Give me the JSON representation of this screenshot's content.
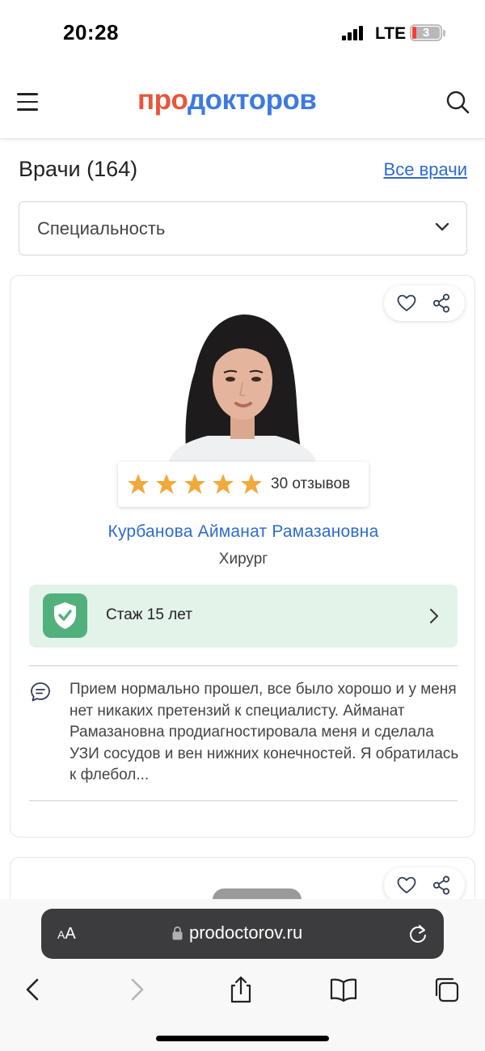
{
  "status_bar": {
    "time": "20:28",
    "network": "LTE",
    "battery": "3"
  },
  "header": {
    "logo_part1": "про",
    "logo_part2": "докторов"
  },
  "section": {
    "title": "Врачи (164)",
    "all_link": "Все врачи"
  },
  "filter": {
    "specialty_label": "Специальность"
  },
  "doctor": {
    "rating_stars": 5,
    "reviews": "30 отзывов",
    "name": "Курбанова Айманат Рамазановна",
    "specialty": "Хирург",
    "experience": "Стаж 15 лет",
    "review_text": "Прием нормально прошел, все было хорошо и у меня нет никаких претензий к специалисту. Айманат Рамазановна продиагностировала меня и сделала УЗИ сосудов и вен нижних конечностей. Я обратилась к флебол..."
  },
  "browser": {
    "aa_small": "A",
    "aa_large": "A",
    "url": "prodoctorov.ru"
  },
  "colors": {
    "logo_red": "#e8553b",
    "logo_blue": "#3d7ae0",
    "link_blue": "#2e6bd1",
    "star_orange": "#f2a93b",
    "experience_bg": "#e3f3ea",
    "shield_green": "#52b07d"
  }
}
